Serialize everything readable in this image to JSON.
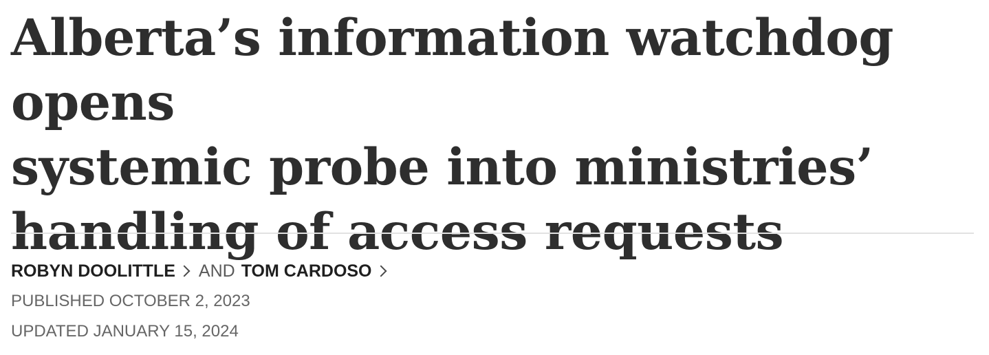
{
  "article": {
    "headline_lines": [
      "Alberta’s information watchdog opens",
      "systemic probe into ministries’",
      "handling of access requests"
    ],
    "authors": [
      {
        "name": "ROBYN DOOLITTLE"
      },
      {
        "name": "TOM CARDOSO"
      }
    ],
    "author_conjunction": "AND",
    "published": "PUBLISHED OCTOBER 2, 2023",
    "updated": "UPDATED JANUARY 15, 2024",
    "icons": {
      "author_link": "chevron-right-icon"
    },
    "colors": {
      "headline": "#2e2e2e",
      "byline": "#1f1f1f",
      "meta": "#666666",
      "divider": "#e2e2e2"
    }
  }
}
